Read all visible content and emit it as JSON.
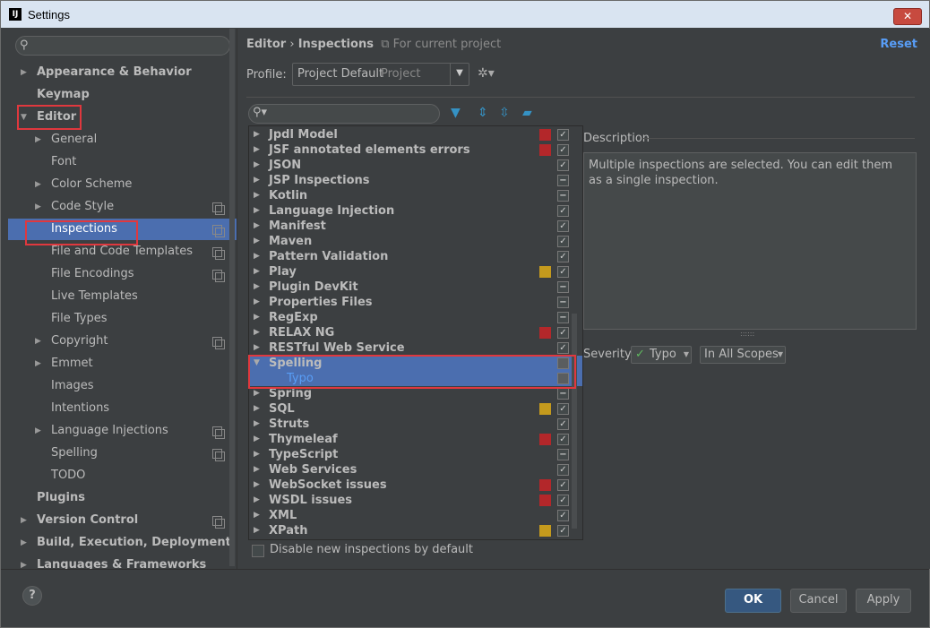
{
  "window": {
    "title": "Settings",
    "app_icon": "IJ",
    "close_label": "✕"
  },
  "sidebar": {
    "search_placeholder": "",
    "items": [
      {
        "label": "Appearance & Behavior",
        "bold": true,
        "arrow": "▶"
      },
      {
        "label": "Keymap",
        "bold": true,
        "arrow": ""
      },
      {
        "label": "Editor",
        "bold": true,
        "arrow": "▼"
      },
      {
        "label": "General",
        "arrow": "▶"
      },
      {
        "label": "Font",
        "arrow": ""
      },
      {
        "label": "Color Scheme",
        "arrow": "▶"
      },
      {
        "label": "Code Style",
        "arrow": "▶",
        "copy_icon": true
      },
      {
        "label": "Inspections",
        "arrow": "",
        "copy_icon": true,
        "selected": true
      },
      {
        "label": "File and Code Templates",
        "arrow": "",
        "copy_icon": true
      },
      {
        "label": "File Encodings",
        "arrow": "",
        "copy_icon": true
      },
      {
        "label": "Live Templates",
        "arrow": ""
      },
      {
        "label": "File Types",
        "arrow": ""
      },
      {
        "label": "Copyright",
        "arrow": "▶",
        "copy_icon": true
      },
      {
        "label": "Emmet",
        "arrow": "▶"
      },
      {
        "label": "Images",
        "arrow": ""
      },
      {
        "label": "Intentions",
        "arrow": ""
      },
      {
        "label": "Language Injections",
        "arrow": "▶",
        "copy_icon": true
      },
      {
        "label": "Spelling",
        "arrow": "",
        "copy_icon": true
      },
      {
        "label": "TODO",
        "arrow": ""
      },
      {
        "label": "Plugins",
        "bold": true,
        "arrow": ""
      },
      {
        "label": "Version Control",
        "bold": true,
        "arrow": "▶",
        "copy_icon": true
      },
      {
        "label": "Build, Execution, Deployment",
        "bold": true,
        "arrow": "▶"
      },
      {
        "label": "Languages & Frameworks",
        "bold": true,
        "arrow": "▶"
      }
    ]
  },
  "header": {
    "breadcrumb_root": "Editor",
    "breadcrumb_sep": "›",
    "breadcrumb_page": "Inspections",
    "project_note": "For current project",
    "reset": "Reset"
  },
  "profile": {
    "label": "Profile:",
    "value": "Project Default",
    "scope": "Project",
    "gear": "✲▾"
  },
  "inspections": [
    {
      "label": "Jpdl Model",
      "sev": "#b3272a",
      "check": "✓"
    },
    {
      "label": "JSF annotated elements errors",
      "sev": "#b3272a",
      "check": "✓"
    },
    {
      "label": "JSON",
      "sev": "",
      "check": "✓"
    },
    {
      "label": "JSP Inspections",
      "sev": "",
      "check": "−"
    },
    {
      "label": "Kotlin",
      "sev": "",
      "check": "−"
    },
    {
      "label": "Language Injection",
      "sev": "",
      "check": "✓"
    },
    {
      "label": "Manifest",
      "sev": "",
      "check": "✓"
    },
    {
      "label": "Maven",
      "sev": "",
      "check": "✓"
    },
    {
      "label": "Pattern Validation",
      "sev": "",
      "check": "✓"
    },
    {
      "label": "Play",
      "sev": "#c49a1d",
      "check": "✓"
    },
    {
      "label": "Plugin DevKit",
      "sev": "",
      "check": "−"
    },
    {
      "label": "Properties Files",
      "sev": "",
      "check": "−"
    },
    {
      "label": "RegExp",
      "sev": "",
      "check": "−"
    },
    {
      "label": "RELAX NG",
      "sev": "#b3272a",
      "check": "✓"
    },
    {
      "label": "RESTful Web Service",
      "sev": "",
      "check": "✓"
    },
    {
      "label": "Spelling",
      "sev": "",
      "check": "",
      "expanded": true,
      "selected": true
    },
    {
      "label": "Typo",
      "sev": "",
      "check": "",
      "child": true,
      "selected": true
    },
    {
      "label": "Spring",
      "sev": "",
      "check": "−"
    },
    {
      "label": "SQL",
      "sev": "#c49a1d",
      "check": "✓"
    },
    {
      "label": "Struts",
      "sev": "",
      "check": "✓"
    },
    {
      "label": "Thymeleaf",
      "sev": "#b3272a",
      "check": "✓"
    },
    {
      "label": "TypeScript",
      "sev": "",
      "check": "−"
    },
    {
      "label": "Web Services",
      "sev": "",
      "check": "✓"
    },
    {
      "label": "WebSocket issues",
      "sev": "#b3272a",
      "check": "✓"
    },
    {
      "label": "WSDL issues",
      "sev": "#b3272a",
      "check": "✓"
    },
    {
      "label": "XML",
      "sev": "",
      "check": "✓"
    },
    {
      "label": "XPath",
      "sev": "#c49a1d",
      "check": "✓"
    }
  ],
  "disable_new": "Disable new inspections by default",
  "description": {
    "label": "Description",
    "text": "Multiple inspections are selected. You can edit them as a single inspection."
  },
  "severity": {
    "label": "Severity:",
    "value": "Typo",
    "scope": "In All Scopes"
  },
  "buttons": {
    "ok": "OK",
    "cancel": "Cancel",
    "apply": "Apply",
    "help": "?"
  },
  "colors": {
    "selection": "#4b6eaf",
    "accent": "#589df6",
    "error": "#b3272a",
    "warning": "#c49a1d"
  }
}
